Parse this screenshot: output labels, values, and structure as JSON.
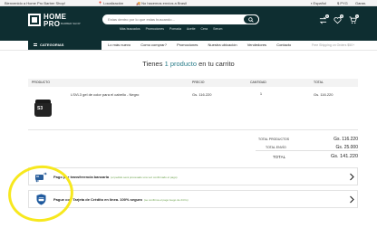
{
  "topbar": {
    "welcome": "Bienvenido a Home Pro Barber Shop!",
    "location": "Localización",
    "shipping": "No hacemos envíos a Brasil",
    "language": "Español",
    "currency": "PYG",
    "guarantee": "Garan."
  },
  "logo": {
    "line1": "HOME",
    "line2": "PRO",
    "tagline": "BARBER SHOP"
  },
  "search": {
    "placeholder": "Estas dentro por lo que estas buscando..."
  },
  "quick_links": [
    "Más buscados",
    "Promociones",
    "Pomada",
    "Aceite",
    "Cera",
    "Serum"
  ],
  "header_icons": {
    "compare_count": "0",
    "wishlist_count": "0",
    "cart_count": "1"
  },
  "nav": {
    "categories_label": "CATEGORIAS",
    "links": [
      "Lo más nuevo",
      "Como comprar?",
      "Promociones",
      "Nuestra ubicación",
      "Vendedores",
      "Contacto"
    ],
    "free_shipping": "Free Shipping on Orders $50+"
  },
  "cart": {
    "title_prefix": "Tienes",
    "title_highlight": "1 producto",
    "title_suffix": "en tu carrito"
  },
  "table": {
    "headers": {
      "product": "PRODUCTO",
      "price": "PRECIO",
      "quantity": "CANTIDAD",
      "total": "TOTAL"
    },
    "rows": [
      {
        "image_label": "S3",
        "name": "LSVL3 gel de color para el cabello - Negro",
        "price": "Gs. 116.220",
        "quantity": "1",
        "total": "Gs. 116.220"
      }
    ]
  },
  "totals": {
    "products_label": "TOTAL PRODUCTOS",
    "products_value": "Gs. 116.220",
    "shipping_label": "TOTAL ENVÍO",
    "shipping_value": "Gs. 25.000",
    "total_label": "TOTAL",
    "total_value": "Gs. 141.220"
  },
  "payments": [
    {
      "title": "Pago por transferencia bancaria",
      "subtitle": "(el pedido será procesado una vez confirmado el pago)"
    },
    {
      "title": "Pague con Tarjeta de Crédito en línea. 100% seguro",
      "subtitle": "(se confirma el pago luego de 24 hs)"
    }
  ],
  "colors": {
    "header_bg": "#0e2e31",
    "accent": "#2a7d8a",
    "highlight_ring": "#f7e81e"
  }
}
